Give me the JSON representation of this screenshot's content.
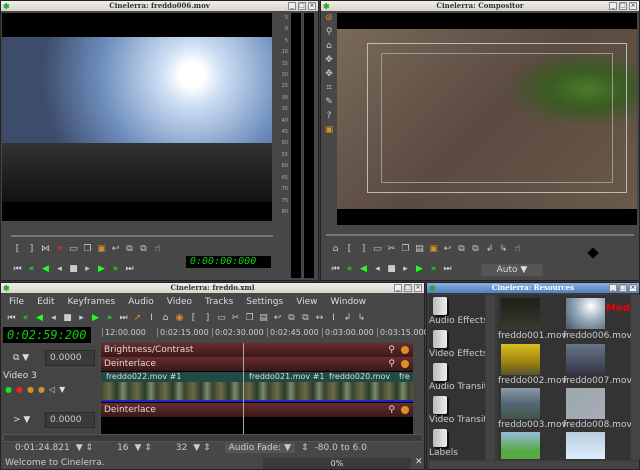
{
  "viewer": {
    "title": "Cinelerra: freddo006.mov",
    "timecode": "0:00:00:000",
    "meter_ticks": [
      "5",
      "0",
      "5",
      "10",
      "15",
      "20",
      "25",
      "30",
      "35",
      "40",
      "45",
      "50",
      "55",
      "60",
      "65",
      "70",
      "75",
      "80"
    ]
  },
  "compositor": {
    "title": "Cinelerra: Compositor",
    "zoom": "Auto"
  },
  "main": {
    "title": "Cinelerra: freddo.xml",
    "menu": [
      "File",
      "Edit",
      "Keyframes",
      "Audio",
      "Video",
      "Tracks",
      "Settings",
      "View",
      "Window"
    ],
    "timecode": "0:02:59:200",
    "ruler": [
      "12:00.000",
      "0:02:15.000",
      "0:02:30.000",
      "0:02:45.000",
      "0:03:00.000",
      "0:03:15.000"
    ],
    "fade_value_1": "0.0000",
    "fade_value_2": "0.0000",
    "track_name": "Video 3",
    "effects": [
      "Brightness/Contrast",
      "Deinterlace",
      "Deinterlace"
    ],
    "clips": [
      "freddo022.mov #1",
      "freddo021.mov #1",
      "freddo020.mov",
      "fre"
    ],
    "position": "0:01:24.821",
    "zoom_sample": "16",
    "zoom_track": "32",
    "audio_fade": "Audio Fade:",
    "fade_range": "-80.0 to 6.0",
    "status": "Welcome to Cinelerra.",
    "progress": "0%"
  },
  "resources": {
    "title": "Cinelerra: Resources",
    "folders": [
      "Audio Effects",
      "Video Effects",
      "Audio Transitions",
      "Video Transitions",
      "Labels"
    ],
    "folders_shown": [
      "Audio Effec",
      "Video Effec",
      "Audio Tran",
      "Video Trans",
      "Labels"
    ],
    "media": [
      "freddo001.mov",
      "freddo006.mov",
      "freddo002.mov",
      "freddo007.mov",
      "freddo003.mov",
      "freddo008.mov"
    ],
    "label": "Med"
  }
}
